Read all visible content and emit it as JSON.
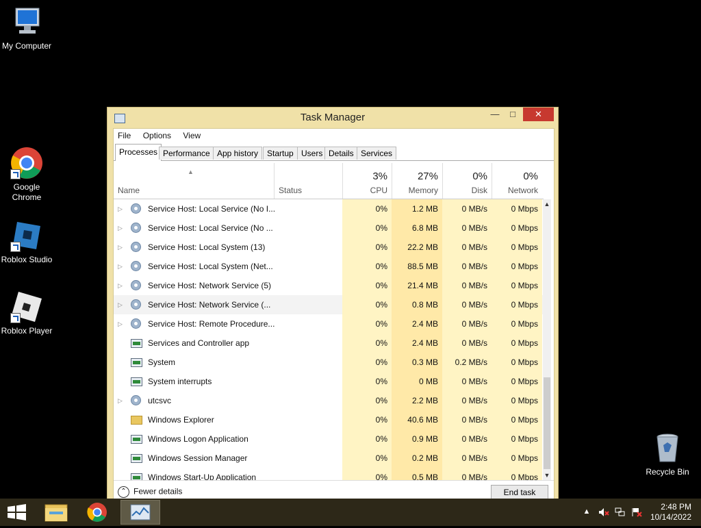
{
  "desktop": {
    "icons": [
      {
        "label": "My Computer"
      },
      {
        "label": "Google Chrome"
      },
      {
        "label": "Roblox Studio"
      },
      {
        "label": "Roblox Player"
      },
      {
        "label": "Recycle Bin"
      }
    ]
  },
  "window": {
    "title": "Task Manager",
    "minimize": "—",
    "maximize": "□",
    "close": "✕",
    "menu": [
      "File",
      "Options",
      "View"
    ],
    "tabs": [
      "Processes",
      "Performance",
      "App history",
      "Startup",
      "Users",
      "Details",
      "Services"
    ],
    "active_tab": "Processes",
    "columns": {
      "name": "Name",
      "status": "Status",
      "cpu": {
        "pct": "3%",
        "label": "CPU"
      },
      "memory": {
        "pct": "27%",
        "label": "Memory"
      },
      "disk": {
        "pct": "0%",
        "label": "Disk"
      },
      "network": {
        "pct": "0%",
        "label": "Network"
      }
    },
    "processes": [
      {
        "name": "Service Host: Local Service (No I...",
        "cpu": "0%",
        "mem": "1.2 MB",
        "disk": "0 MB/s",
        "net": "0 Mbps",
        "icon": "gear-icon",
        "expand": true
      },
      {
        "name": "Service Host: Local Service (No ...",
        "cpu": "0%",
        "mem": "6.8 MB",
        "disk": "0 MB/s",
        "net": "0 Mbps",
        "icon": "gear-icon",
        "expand": true
      },
      {
        "name": "Service Host: Local System (13)",
        "cpu": "0%",
        "mem": "22.2 MB",
        "disk": "0 MB/s",
        "net": "0 Mbps",
        "icon": "gear-icon",
        "expand": true
      },
      {
        "name": "Service Host: Local System (Net...",
        "cpu": "0%",
        "mem": "88.5 MB",
        "disk": "0 MB/s",
        "net": "0 Mbps",
        "icon": "gear-icon",
        "expand": true
      },
      {
        "name": "Service Host: Network Service (5)",
        "cpu": "0%",
        "mem": "21.4 MB",
        "disk": "0 MB/s",
        "net": "0 Mbps",
        "icon": "gear-icon",
        "expand": true
      },
      {
        "name": "Service Host: Network Service (...",
        "cpu": "0%",
        "mem": "0.8 MB",
        "disk": "0 MB/s",
        "net": "0 Mbps",
        "icon": "gear-icon",
        "expand": true,
        "selected": true
      },
      {
        "name": "Service Host: Remote Procedure...",
        "cpu": "0%",
        "mem": "2.4 MB",
        "disk": "0 MB/s",
        "net": "0 Mbps",
        "icon": "gear-icon",
        "expand": true
      },
      {
        "name": "Services and Controller app",
        "cpu": "0%",
        "mem": "2.4 MB",
        "disk": "0 MB/s",
        "net": "0 Mbps",
        "icon": "window-icon",
        "expand": false
      },
      {
        "name": "System",
        "cpu": "0%",
        "mem": "0.3 MB",
        "disk": "0.2 MB/s",
        "net": "0 Mbps",
        "icon": "window-icon",
        "expand": false
      },
      {
        "name": "System interrupts",
        "cpu": "0%",
        "mem": "0 MB",
        "disk": "0 MB/s",
        "net": "0 Mbps",
        "icon": "window-icon",
        "expand": false
      },
      {
        "name": "utcsvc",
        "cpu": "0%",
        "mem": "2.2 MB",
        "disk": "0 MB/s",
        "net": "0 Mbps",
        "icon": "gear-icon",
        "expand": true
      },
      {
        "name": "Windows Explorer",
        "cpu": "0%",
        "mem": "40.6 MB",
        "disk": "0 MB/s",
        "net": "0 Mbps",
        "icon": "folder-icon",
        "expand": false
      },
      {
        "name": "Windows Logon Application",
        "cpu": "0%",
        "mem": "0.9 MB",
        "disk": "0 MB/s",
        "net": "0 Mbps",
        "icon": "window-icon",
        "expand": false
      },
      {
        "name": "Windows Session Manager",
        "cpu": "0%",
        "mem": "0.2 MB",
        "disk": "0 MB/s",
        "net": "0 Mbps",
        "icon": "window-icon",
        "expand": false
      },
      {
        "name": "Windows Start-Up Application",
        "cpu": "0%",
        "mem": "0.5 MB",
        "disk": "0 MB/s",
        "net": "0 Mbps",
        "icon": "window-icon",
        "expand": false
      }
    ],
    "footer": {
      "fewer_details": "Fewer details",
      "end_task": "End task"
    }
  },
  "taskbar": {
    "time": "2:48 PM",
    "date": "10/14/2022"
  },
  "colors": {
    "window_frame": "#f0e1a8",
    "close_button": "#c7392f",
    "taskbar": "#2d2818",
    "heat_light": "#fff4c4",
    "heat_memory": "#ffe9a8"
  }
}
